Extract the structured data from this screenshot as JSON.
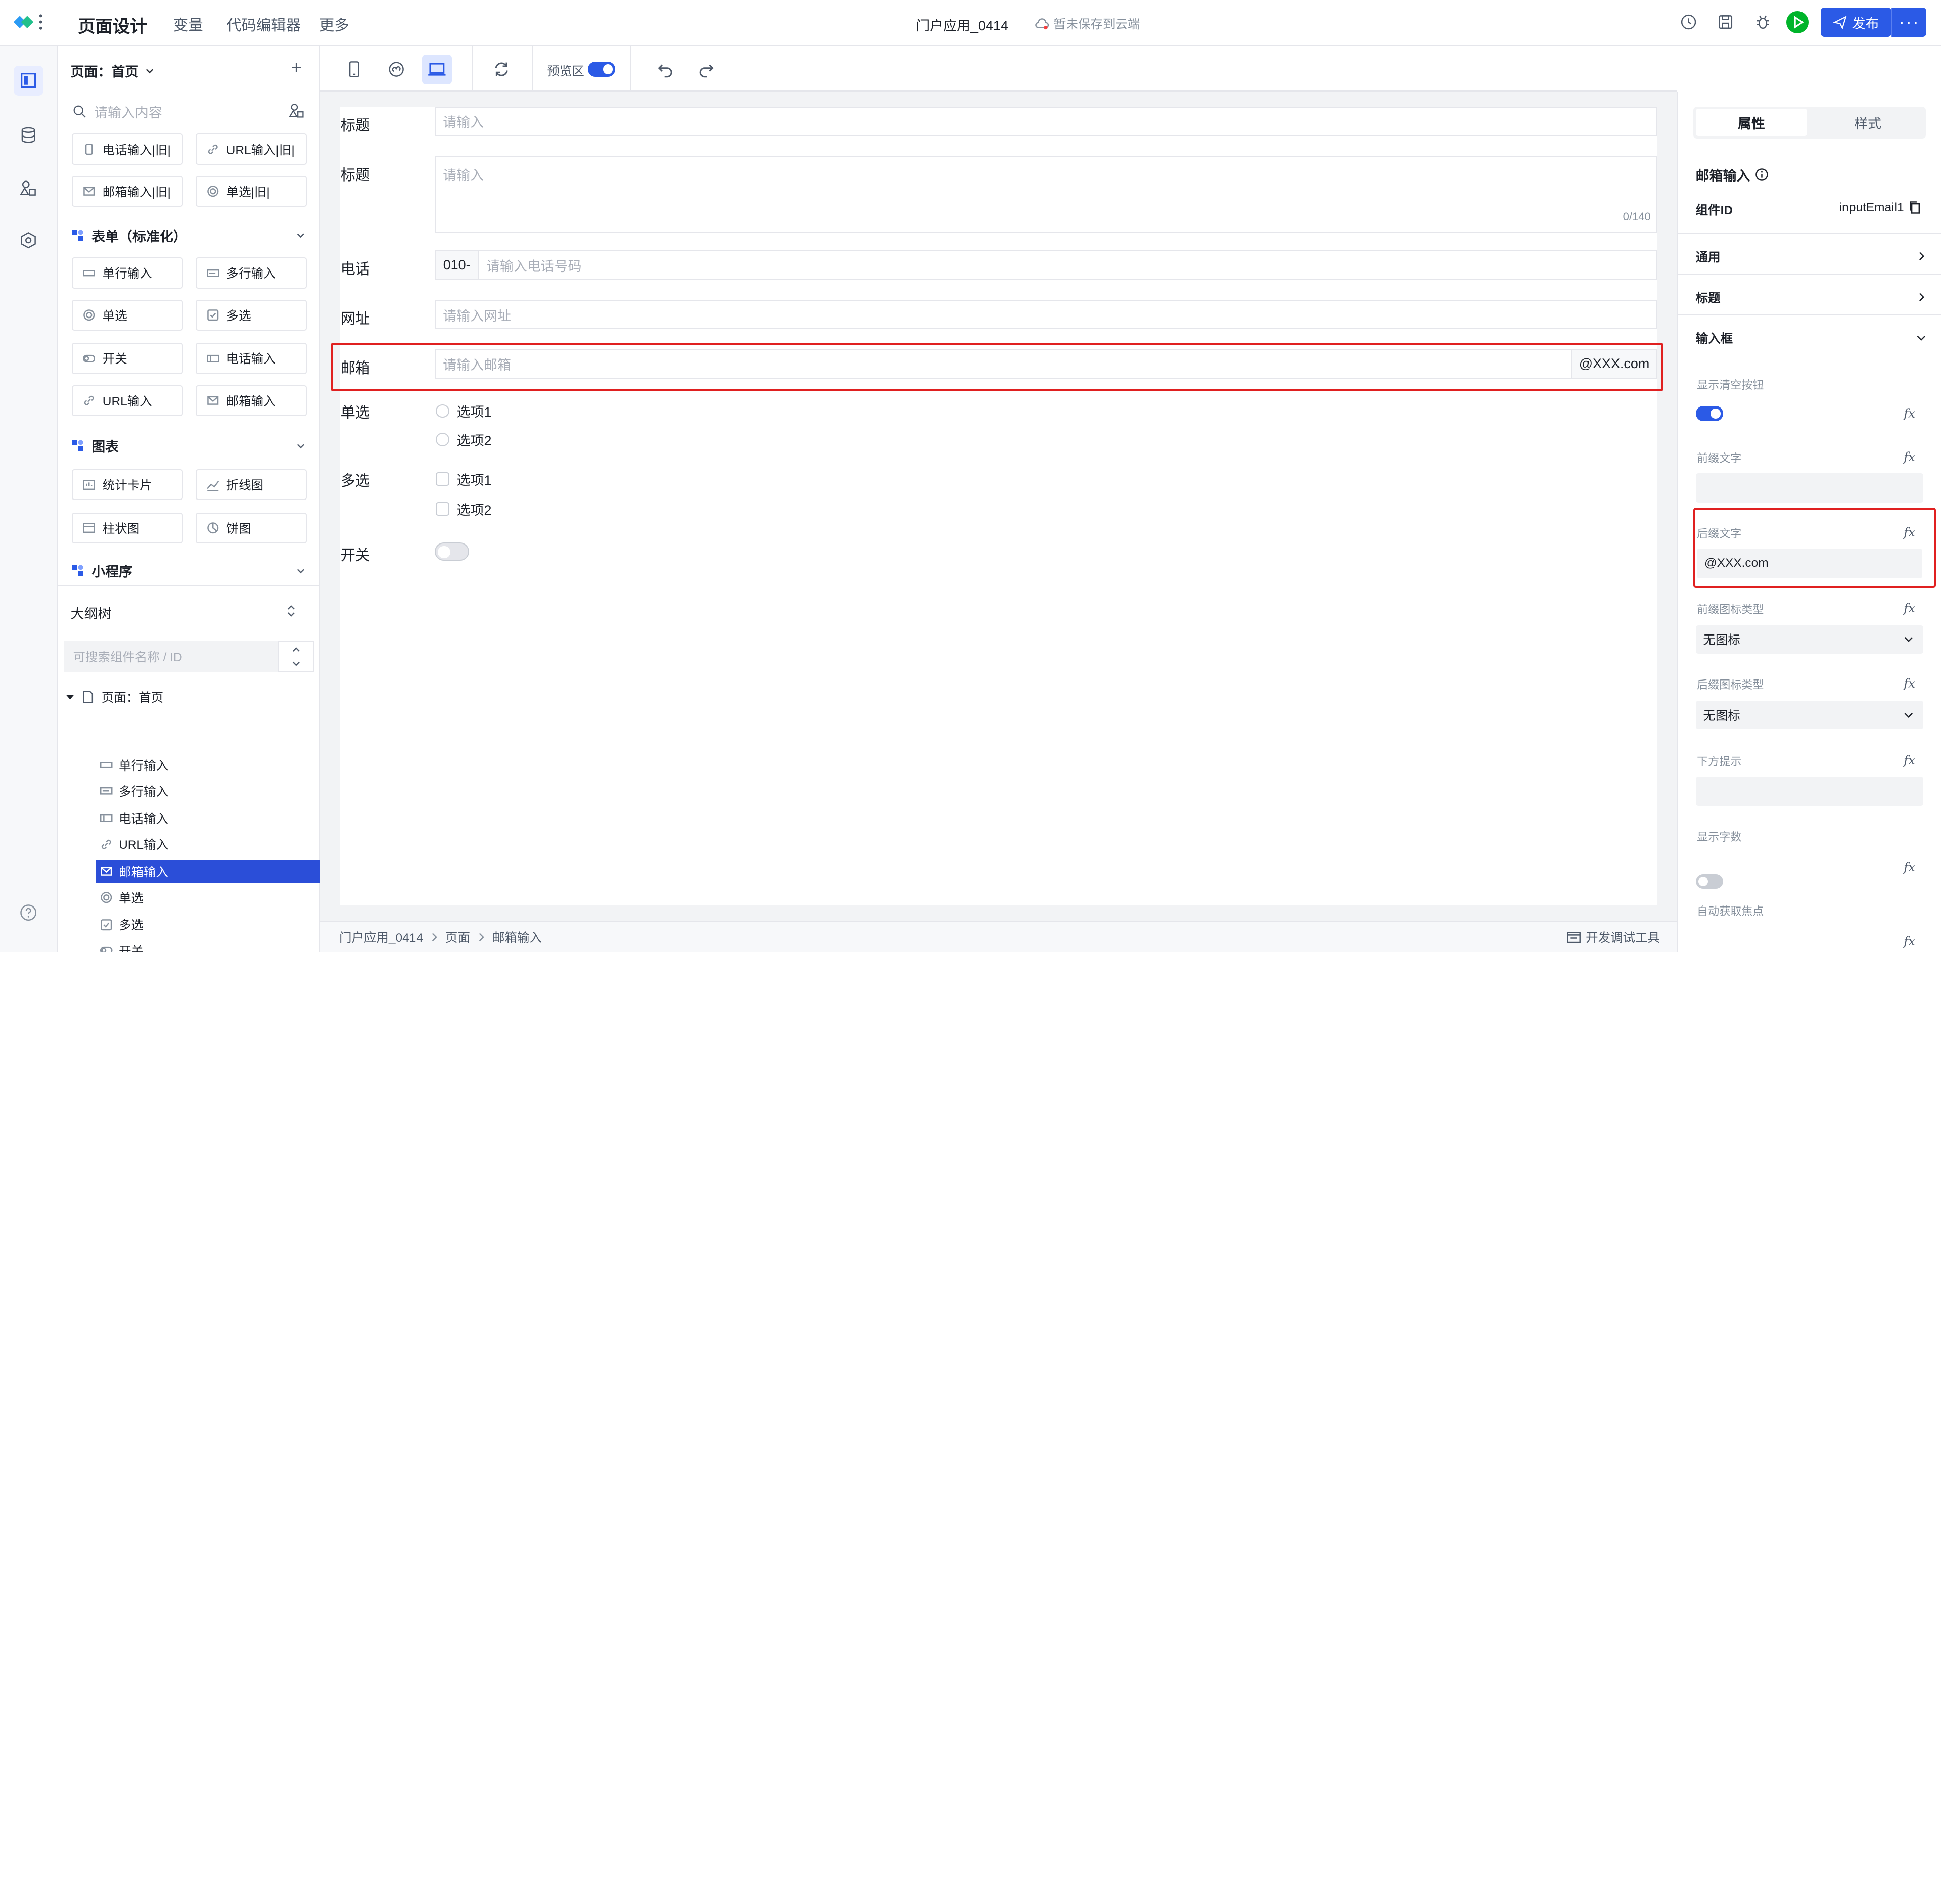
{
  "topbar": {
    "title": "页面设计",
    "nav": [
      "变量",
      "代码编辑器",
      "更多"
    ],
    "app_name": "门户应用_0414",
    "save_status": "暂未保存到云端",
    "publish_label": "发布",
    "more_label": "···",
    "accent": "#2b5ae6"
  },
  "left_panel": {
    "page_selector": "页面：首页",
    "add_label": "+",
    "search_placeholder": "请输入内容",
    "legacy_items": [
      "电话输入|旧|",
      "URL输入|旧|",
      "邮箱输入|旧|",
      "单选|旧|"
    ],
    "sections": [
      {
        "title": "表单（标准化）",
        "items": [
          "单行输入",
          "多行输入",
          "单选",
          "多选",
          "开关",
          "电话输入",
          "URL输入",
          "邮箱输入"
        ]
      },
      {
        "title": "图表",
        "items": [
          "统计卡片",
          "折线图",
          "柱状图",
          "饼图"
        ]
      },
      {
        "title": "小程序",
        "items": []
      }
    ],
    "outline": {
      "title": "大纲树",
      "search_placeholder": "可搜索组件名称 / ID",
      "root": "页面：首页",
      "nodes": [
        "单行输入",
        "多行输入",
        "电话输入",
        "URL输入",
        "邮箱输入",
        "单选",
        "多选",
        "开关"
      ],
      "selected": "邮箱输入"
    }
  },
  "toolbar": {
    "preview_label": "预览区",
    "preview_on": true
  },
  "form": {
    "title1_label": "标题",
    "title1_placeholder": "请输入",
    "title2_label": "标题",
    "title2_placeholder": "请输入",
    "title2_counter": "0/140",
    "phone_label": "电话",
    "phone_prefix": "010-",
    "phone_placeholder": "请输入电话号码",
    "url_label": "网址",
    "url_placeholder": "请输入网址",
    "email_label": "邮箱",
    "email_placeholder": "请输入邮箱",
    "email_suffix": "@XXX.com",
    "radio_label": "单选",
    "radio_options": [
      "选项1",
      "选项2"
    ],
    "checkbox_label": "多选",
    "checkbox_options": [
      "选项1",
      "选项2"
    ],
    "switch_label": "开关"
  },
  "footer": {
    "breadcrumb": [
      "门户应用_0414",
      "页面",
      "邮箱输入"
    ],
    "devtools_label": "开发调试工具"
  },
  "right_panel": {
    "tabs": [
      "属性",
      "样式"
    ],
    "active_tab": "属性",
    "component_name": "邮箱输入",
    "component_id_label": "组件ID",
    "component_id": "inputEmail1",
    "groups": [
      "通用",
      "标题",
      "输入框"
    ],
    "fields": {
      "clear_btn_label": "显示清空按钮",
      "clear_btn_on": true,
      "prefix_text_label": "前缀文字",
      "prefix_text_value": "",
      "suffix_text_label": "后缀文字",
      "suffix_text_value": "@XXX.com",
      "prefix_icon_label": "前缀图标类型",
      "prefix_icon_value": "无图标",
      "suffix_icon_label": "后缀图标类型",
      "suffix_icon_value": "无图标",
      "hint_label": "下方提示",
      "hint_value": "",
      "show_count_label": "显示字数",
      "show_count_on": false,
      "autofocus_label": "自动获取焦点"
    },
    "fx_label": "fx"
  }
}
